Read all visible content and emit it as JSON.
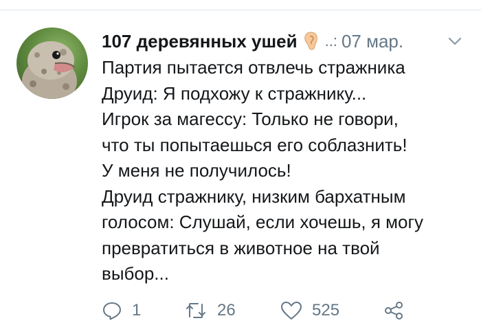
{
  "tweet": {
    "author_name": "107 деревянных ушей",
    "author_emoji": "ear-emoji",
    "separator": "..:",
    "date": "07 мар.",
    "lines": [
      "Партия пытается отвлечь стражника",
      "Друид: Я подхожу к стражнику...",
      "Игрок за магессу: Только не говори,",
      "что ты попытаешься его соблазнить!",
      "У меня не получилось!",
      "Друид стражнику, низким бархатным",
      "голосом: Слушай, если хочешь, я могу",
      "превратиться в животное на твой",
      "выбор..."
    ],
    "reply_count": "1",
    "retweet_count": "26",
    "like_count": "525"
  },
  "colors": {
    "text": "#14171a",
    "muted": "#657786",
    "divider": "#e1e8ed"
  },
  "icons": {
    "menu": "chevron-down-icon",
    "reply": "reply-icon",
    "retweet": "retweet-icon",
    "like": "heart-icon",
    "share": "share-icon"
  }
}
